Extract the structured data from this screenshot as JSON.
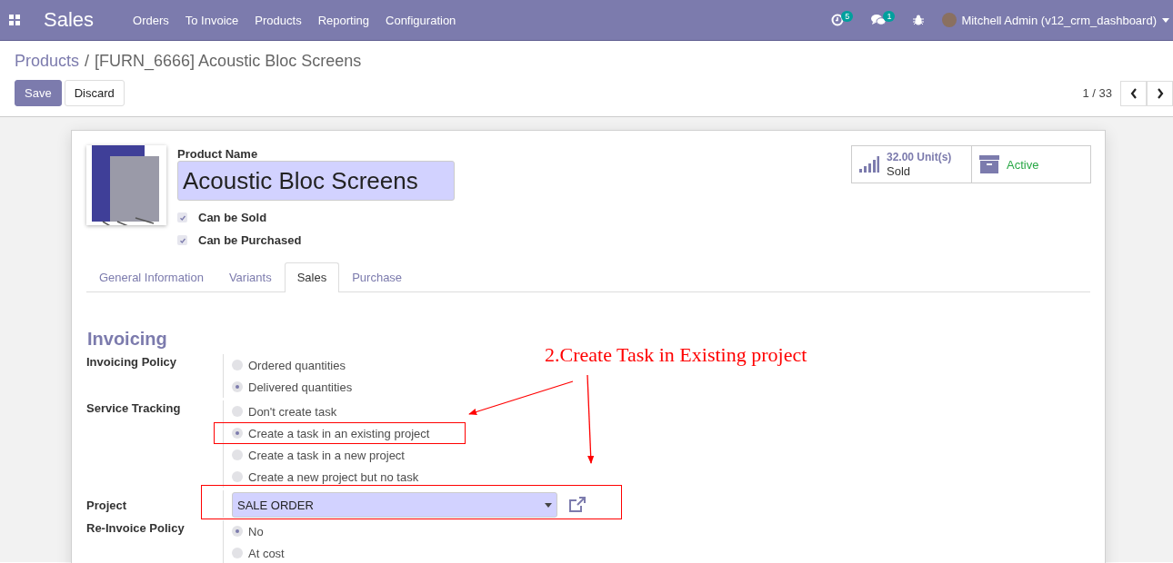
{
  "navbar": {
    "app_name": "Sales",
    "menu": [
      "Orders",
      "To Invoice",
      "Products",
      "Reporting",
      "Configuration"
    ],
    "activity_count": "5",
    "message_count": "1",
    "user": "Mitchell Admin (v12_crm_dashboard)"
  },
  "breadcrumb": {
    "parent": "Products",
    "separator": "/",
    "current": "[FURN_6666] Acoustic Bloc Screens"
  },
  "actions": [
    "Save",
    "Discard"
  ],
  "pager": "1 / 33",
  "product": {
    "name_label": "Product Name",
    "name": "Acoustic Bloc Screens",
    "options": [
      {
        "label": "Can be Sold",
        "checked": true
      },
      {
        "label": "Can be Purchased",
        "checked": true
      }
    ]
  },
  "stats": {
    "sold_value": "32.00",
    "sold_unit": "Unit(s)",
    "sold_label": "Sold",
    "active_label": "Active"
  },
  "tabs": [
    {
      "label": "General Information",
      "selected": false
    },
    {
      "label": "Variants",
      "selected": false
    },
    {
      "label": "Sales",
      "selected": true
    },
    {
      "label": "Purchase",
      "selected": false
    }
  ],
  "section_title": "Invoicing",
  "fields": [
    {
      "label": "Invoicing Policy",
      "kind": "radio",
      "options": [
        {
          "label": "Ordered quantities",
          "selected": false,
          "highlighted": false
        },
        {
          "label": "Delivered quantities",
          "selected": true,
          "highlighted": false
        }
      ]
    },
    {
      "label": "Service Tracking",
      "kind": "radio",
      "options": [
        {
          "label": "Don't create task",
          "selected": false,
          "highlighted": false
        },
        {
          "label": "Create a task in an existing project",
          "selected": true,
          "highlighted": true
        },
        {
          "label": "Create a task in a new project",
          "selected": false,
          "highlighted": false
        },
        {
          "label": "Create a new project but no task",
          "selected": false,
          "highlighted": false
        }
      ]
    },
    {
      "label": "Project",
      "kind": "select",
      "value": "SALE ORDER",
      "highlighted": true
    },
    {
      "label": "Re-Invoice Policy",
      "kind": "radio",
      "options": [
        {
          "label": "No",
          "selected": true,
          "highlighted": false
        },
        {
          "label": "At cost",
          "selected": false,
          "highlighted": false
        }
      ]
    }
  ],
  "annotation": {
    "text": "2.Create Task in Existing project"
  }
}
